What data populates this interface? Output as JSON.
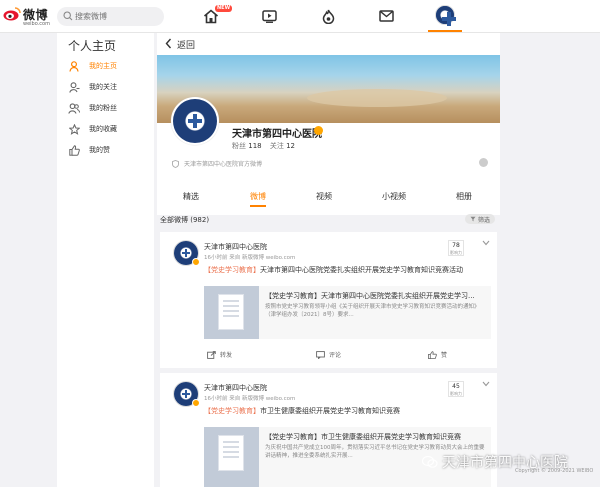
{
  "topbar": {
    "brand": "微博",
    "brand_url": "weibo.com",
    "search_placeholder": "搜索微博",
    "new_badge": "NEW",
    "accent_color": "#ff8200"
  },
  "sidebar": {
    "title": "个人主页",
    "items": [
      {
        "label": "我的主页",
        "icon": "person-icon",
        "active": true
      },
      {
        "label": "我的关注",
        "icon": "following-icon",
        "active": false
      },
      {
        "label": "我的粉丝",
        "icon": "fans-icon",
        "active": false
      },
      {
        "label": "我的收藏",
        "icon": "star-icon",
        "active": false
      },
      {
        "label": "我的赞",
        "icon": "thumb-up-icon",
        "active": false
      }
    ]
  },
  "back": {
    "label": "返回"
  },
  "profile": {
    "name": "天津市第四中心医院",
    "fans_label": "粉丝",
    "fans_count": "118",
    "follow_label": "关注",
    "follow_count": "12",
    "verified_desc": "天津市第四中心医院官方微博"
  },
  "tabs": [
    "精选",
    "微博",
    "视频",
    "小视频",
    "相册"
  ],
  "active_tab": "微博",
  "filter": {
    "label": "全部微博",
    "count": "(982)",
    "button": "筛选"
  },
  "posts": [
    {
      "author": "天津市第四中心医院",
      "meta": "16小时前  来自 新版微博 weibo.com",
      "score": "78",
      "score_label": "影响力",
      "tag": "【党史学习教育】",
      "text": "天津市第四中心医院党委扎实组织开展党史学习教育知识竞赛活动",
      "link_title": "【党史学习教育】天津市第四中心医院党委扎实组织开展党史学习...",
      "link_desc": "按照市党史学习教育领导小组《关于组织开展天津市党史学习教育知识竞赛活动的通知》（津学组办发〔2021〕8号）要求...",
      "repost": "转发",
      "comment": "评论",
      "like": "赞"
    },
    {
      "author": "天津市第四中心医院",
      "meta": "16小时前  来自 新版微博 weibo.com",
      "score": "45",
      "score_label": "影响力",
      "tag": "【党史学习教育】",
      "text": "市卫生健康委组织开展党史学习教育知识竞赛",
      "link_title": "【党史学习教育】市卫生健康委组织开展党史学习教育知识竞赛",
      "link_desc": "为庆祝中国共产党成立100周年，贯彻落实习近平总书记在党史学习教育动员大会上的重要讲话精神，推进全委系统扎实开展..."
    }
  ],
  "watermark": "天津市第四中心医院",
  "copyright": "Copyright © 2009-2021 WEIBO"
}
